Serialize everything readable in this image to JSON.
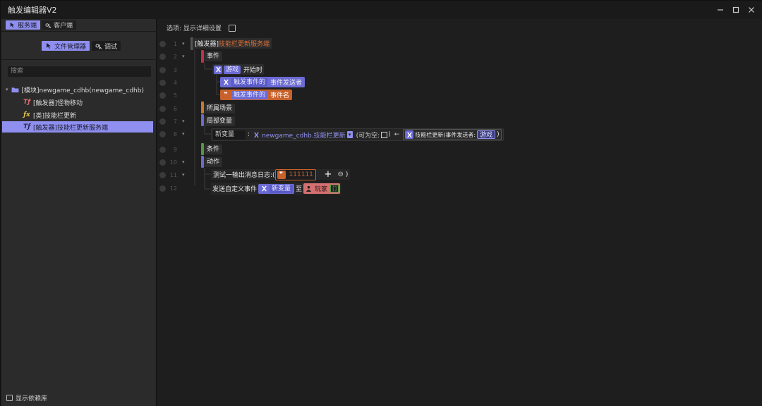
{
  "app": {
    "title": "触发编辑器V2"
  },
  "sidebar": {
    "tabs": [
      {
        "label": "服务端"
      },
      {
        "label": "客户端"
      }
    ],
    "subtabs": [
      {
        "label": "文件管理器"
      },
      {
        "label": "调试"
      }
    ],
    "search_placeholder": "搜索",
    "tree": [
      {
        "label": "[模块]newgame_cdhb(newgame_cdhb)",
        "icon": "folder-icon"
      },
      {
        "label": "[触发器]怪物移动",
        "icon": "trigger-icon"
      },
      {
        "label": "[类]技能栏更新",
        "icon": "function-icon"
      },
      {
        "label": "[触发器]技能栏更新服务端",
        "icon": "trigger-icon"
      }
    ],
    "footer_label": "显示依赖库"
  },
  "main": {
    "options_label": "选项: 显示详细设置",
    "line_numbers": [
      "1",
      "2",
      "3",
      "4",
      "5",
      "6",
      "7",
      "8",
      "9",
      "10",
      "11",
      "12"
    ],
    "line1": {
      "prefix": "[触发器]",
      "name": "技能栏更新服务端"
    },
    "line2": {
      "label": "事件"
    },
    "line3": {
      "chip": "游戏",
      "text": "开始时"
    },
    "line4": {
      "chip": "触发事件的",
      "text": "事件发送者"
    },
    "line5": {
      "chip": "触发事件的",
      "text": "事件名"
    },
    "line6": {
      "label": "所属场景"
    },
    "line7": {
      "label": "局部变量"
    },
    "line8": {
      "var_name": "新变量",
      "colon": ":",
      "type_text": "newgame_cdhb.技能栏更新",
      "nullable_label": "(可为空:",
      "close_paren": ")",
      "arrow": "←",
      "func_call": "技能栏更新(事件发送者:",
      "func_arg": "游戏",
      "func_close": ")"
    },
    "line9": {
      "label": "条件"
    },
    "line10": {
      "label": "动作"
    },
    "line11": {
      "text": "测试一输出消息日志:(",
      "value": "111111",
      "plus": "+",
      "minus": "⊖",
      "close": ")"
    },
    "line12": {
      "text": "发送自定义事件",
      "var_chip": "新变量",
      "to": "至",
      "player_chip": "玩家",
      "bracket": "[]"
    }
  },
  "colors": {
    "accent": "#8f8ff0",
    "purple": "#6b6bd6",
    "orange": "#c8612a",
    "event_red": "#c0304a",
    "local_blue": "#6a6ad0",
    "cond_green": "#4f9a3e",
    "scene_orange": "#c87a2a"
  }
}
